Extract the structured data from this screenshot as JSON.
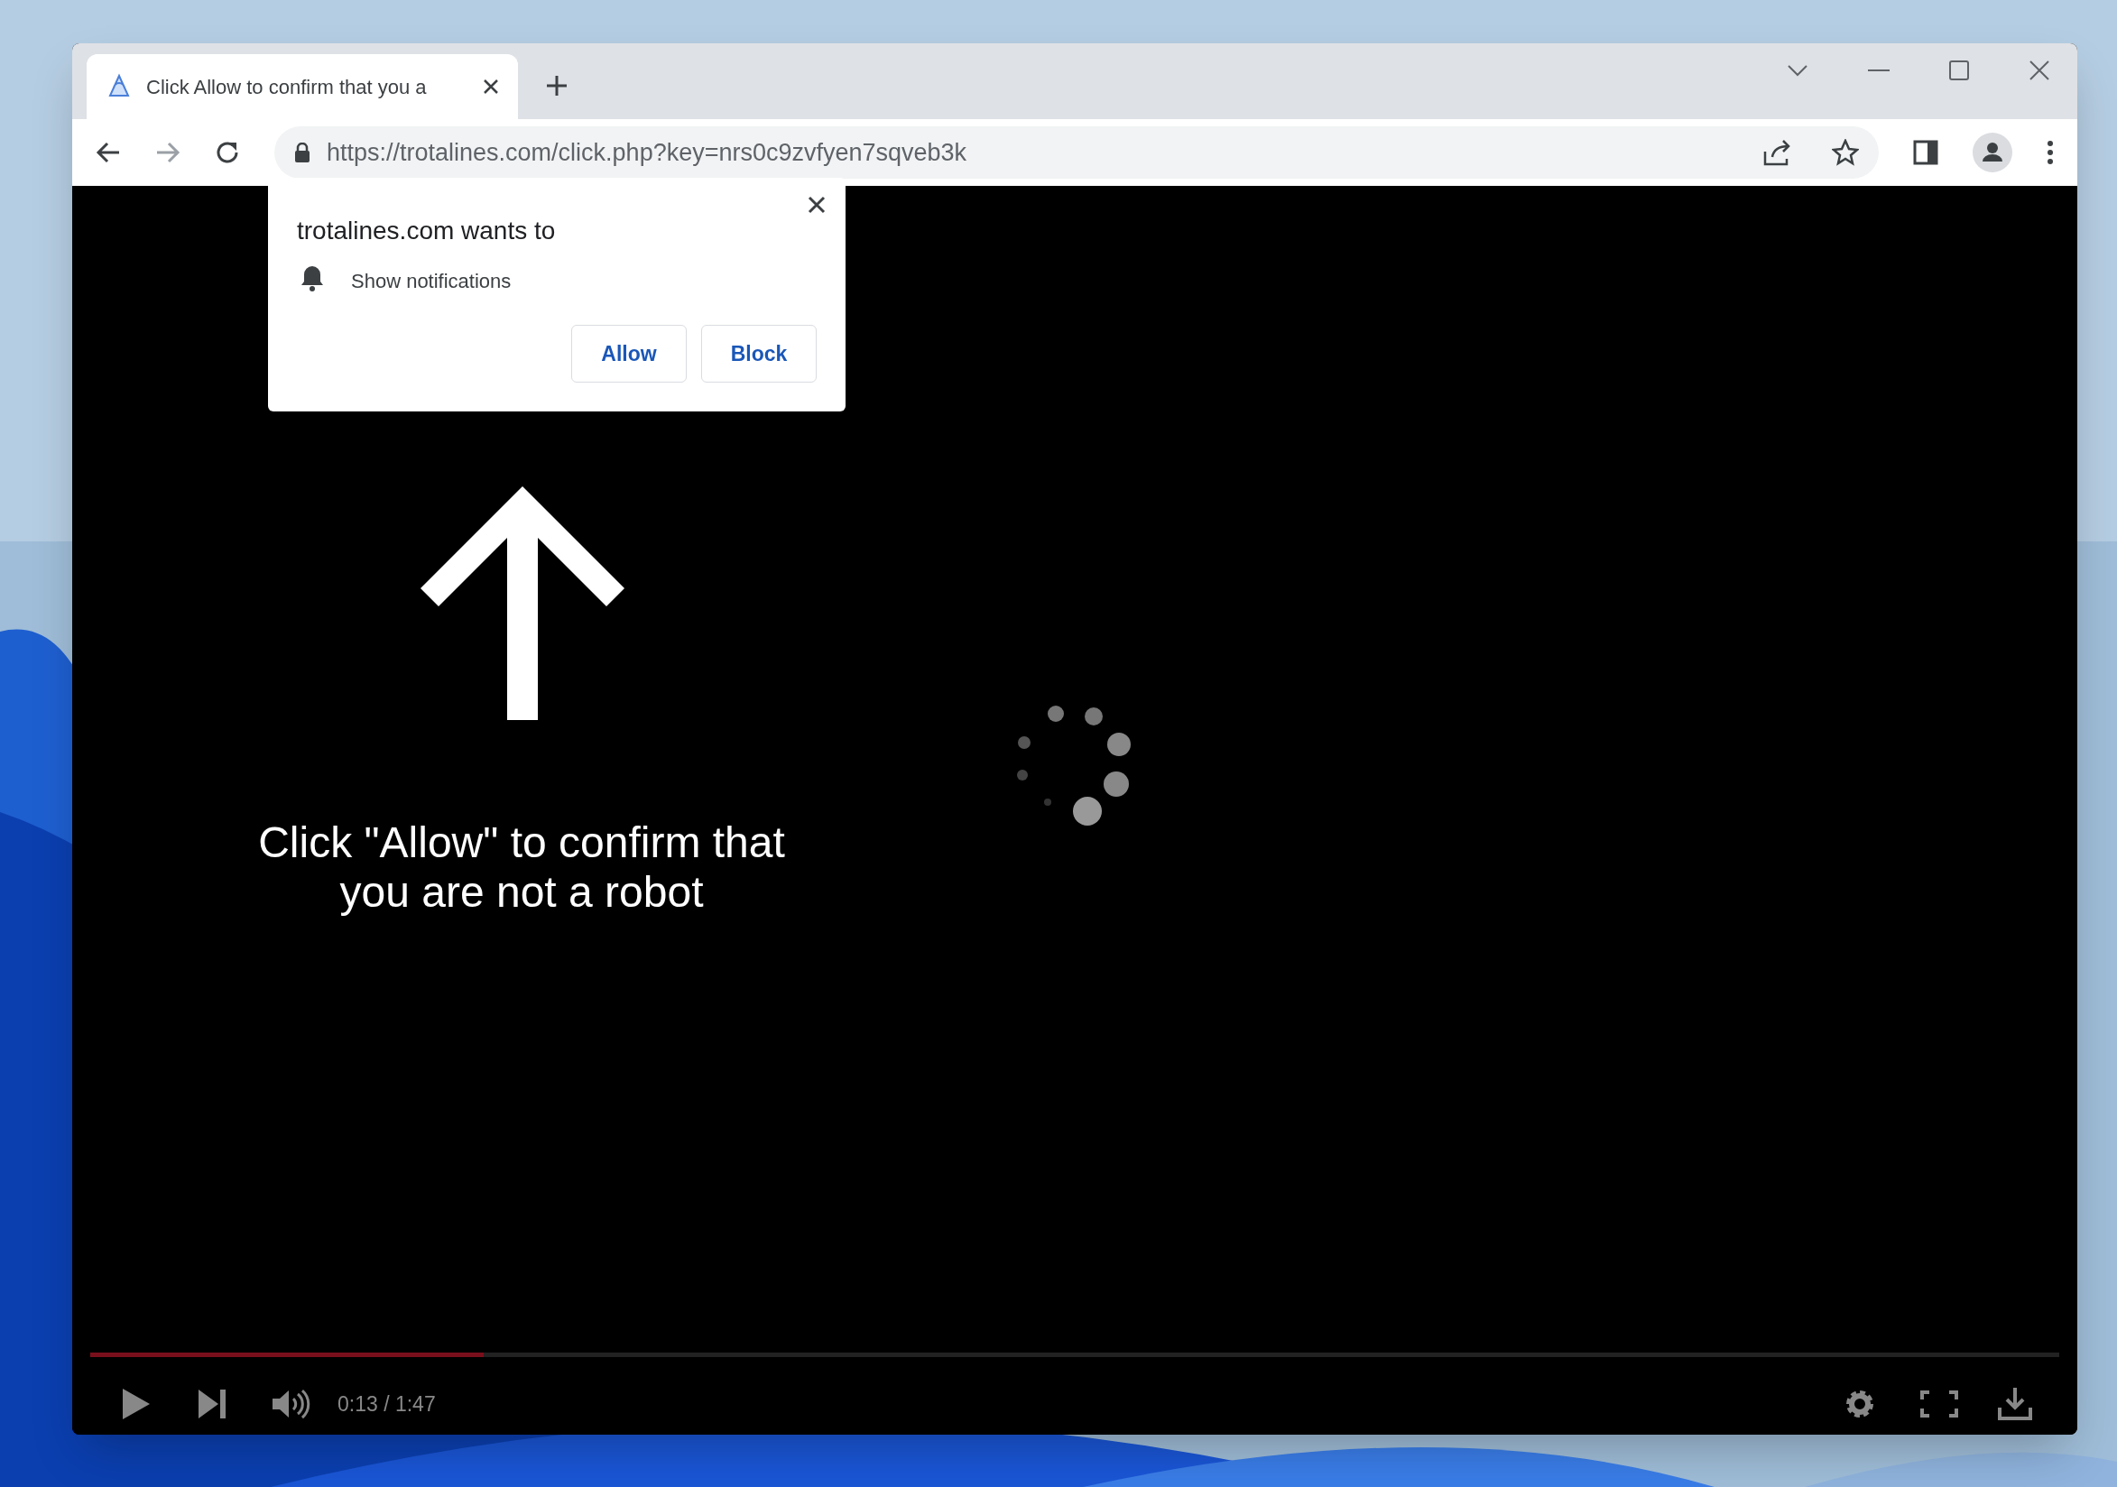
{
  "window": {
    "tab": {
      "title": "Click Allow to confirm that you a",
      "selected": true
    },
    "address": "https://trotalines.com/click.php?key=nrs0c9zvfyen7sqveb3k"
  },
  "permission_popup": {
    "title": "trotalines.com wants to",
    "permission": "Show notifications",
    "buttons": [
      "Allow",
      "Block"
    ]
  },
  "page": {
    "message": "Click \"Allow\" to confirm that you are not a robot"
  },
  "player": {
    "level": 0.2,
    "time": "0:13 / 1:47"
  }
}
